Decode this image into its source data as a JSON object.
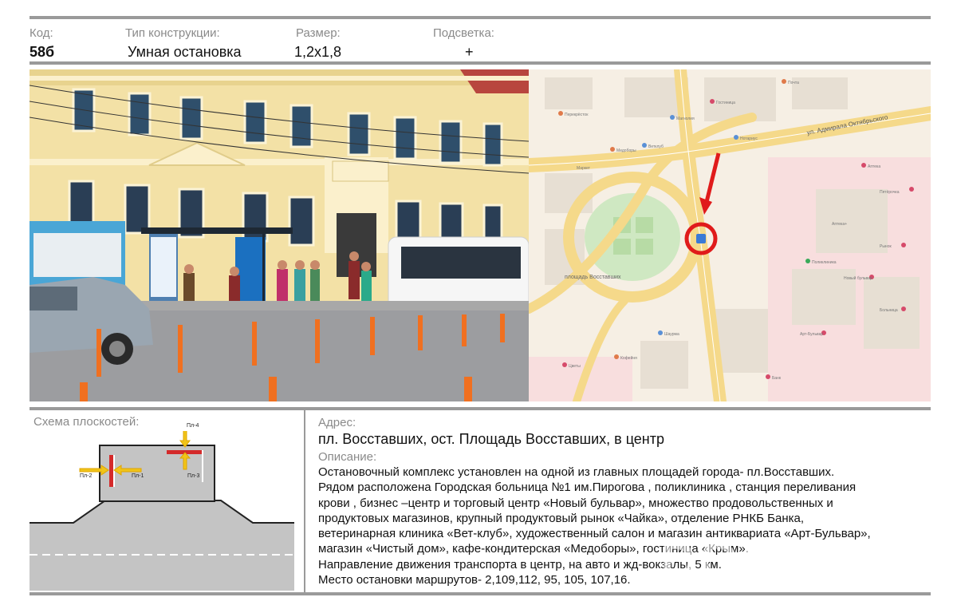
{
  "header": {
    "code_label": "Код:",
    "code_value": "58б",
    "type_label": "Тип конструкции:",
    "type_value": "Умная остановка",
    "size_label": "Размер:",
    "size_value": "1,2х1,8",
    "light_label": "Подсветка:",
    "light_value": "+"
  },
  "map": {
    "street": "ул. Адмирала Октябрьского",
    "square": "площадь Восставших",
    "labels": [
      "Перекрёсток",
      "Медоборы",
      "Ветклуб",
      "Магнолия",
      "Гостиница",
      "Нотариус",
      "Почта",
      "Аптека",
      "Пятёрочка",
      "Новый бульвар",
      "Арт-Бульвар",
      "Больница",
      "Поликлиника",
      "Шаурма",
      "Кофейня",
      "Банк",
      "Цветы",
      "Рынок",
      "Маркет",
      "Аптека+"
    ]
  },
  "scheme": {
    "title": "Схема плоскостей:",
    "pl1": "Пл-1",
    "pl2": "Пл-2",
    "pl3": "Пл-3",
    "pl4": "Пл-4"
  },
  "address": {
    "label": "Адрес:",
    "value": "пл. Восставших, ост. Площадь Восставших, в центр"
  },
  "description": {
    "label": "Описание:",
    "lines": [
      "Остановочный  комплекс установлен на одной из главных площадей города- пл.Восставших.",
      "Рядом расположена  Городская больница №1 им.Пирогова , поликлиника , станция переливания",
      "крови , бизнес –центр и торговый центр «Новый бульвар», множество продовольственных и",
      "продуктовых магазинов, крупный продуктовый рынок «Чайка», отделение РНКБ Банка,",
      "ветеринарная клиника «Вет-клуб»,  художественный салон и магазин антиквариата «Арт-Бульвар»,",
      "магазин «Чистый дом», кафе-кондитерская «Медоборы», гостиница «Крым».",
      "Направление движения транспорта в центр, на авто и жд-вокзалы, 5 км.",
      "Место остановки маршрутов- 2,109,112, 95, 105, 107,16."
    ]
  },
  "watermark": "DOOH.RU",
  "colors": {
    "rule": "#9a9a9a",
    "panel_red": "#d42a2a",
    "arrow_yellow": "#f0c419",
    "map_marker": "#e01b1b"
  }
}
